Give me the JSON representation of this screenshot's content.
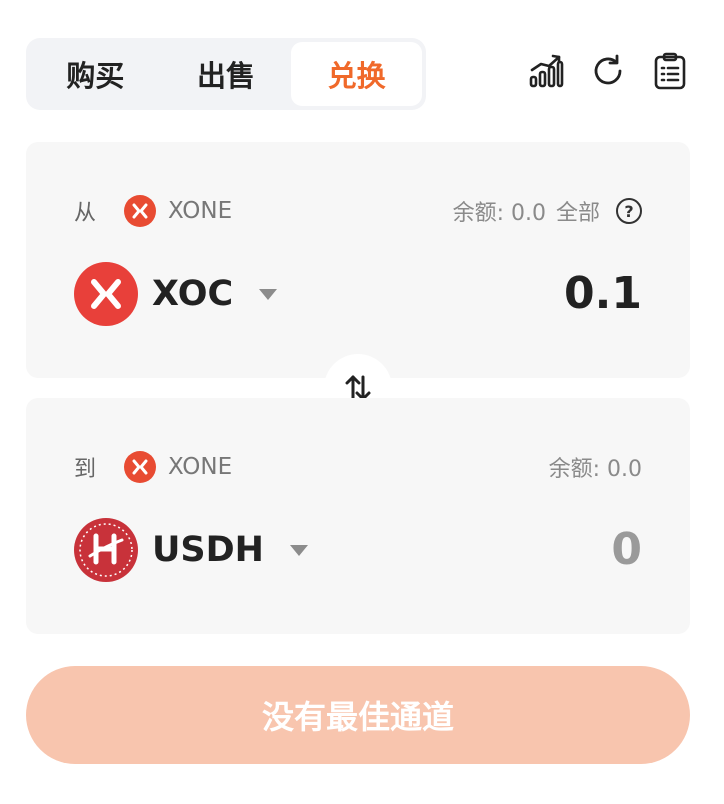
{
  "tabs": [
    {
      "label": "购买",
      "active": false
    },
    {
      "label": "出售",
      "active": false
    },
    {
      "label": "兑换",
      "active": true
    }
  ],
  "toolbar": {
    "icons": [
      "chart-icon",
      "refresh-icon",
      "clipboard-icon"
    ]
  },
  "from": {
    "direction_label": "从",
    "chain": "XONE",
    "balance_label": "余额: 0.0",
    "all_label": "全部",
    "help_symbol": "?",
    "token": "XOC",
    "amount": "0.1"
  },
  "to": {
    "direction_label": "到",
    "chain": "XONE",
    "balance_label": "余额: 0.0",
    "token": "USDH",
    "amount": "0"
  },
  "action": {
    "label": "没有最佳通道"
  },
  "colors": {
    "accent": "#f0692a",
    "button_disabled": "#f8c5ae",
    "panel_bg": "#f7f7f7",
    "xone_red": "#e84b32",
    "usdh_red": "#c8323a"
  }
}
